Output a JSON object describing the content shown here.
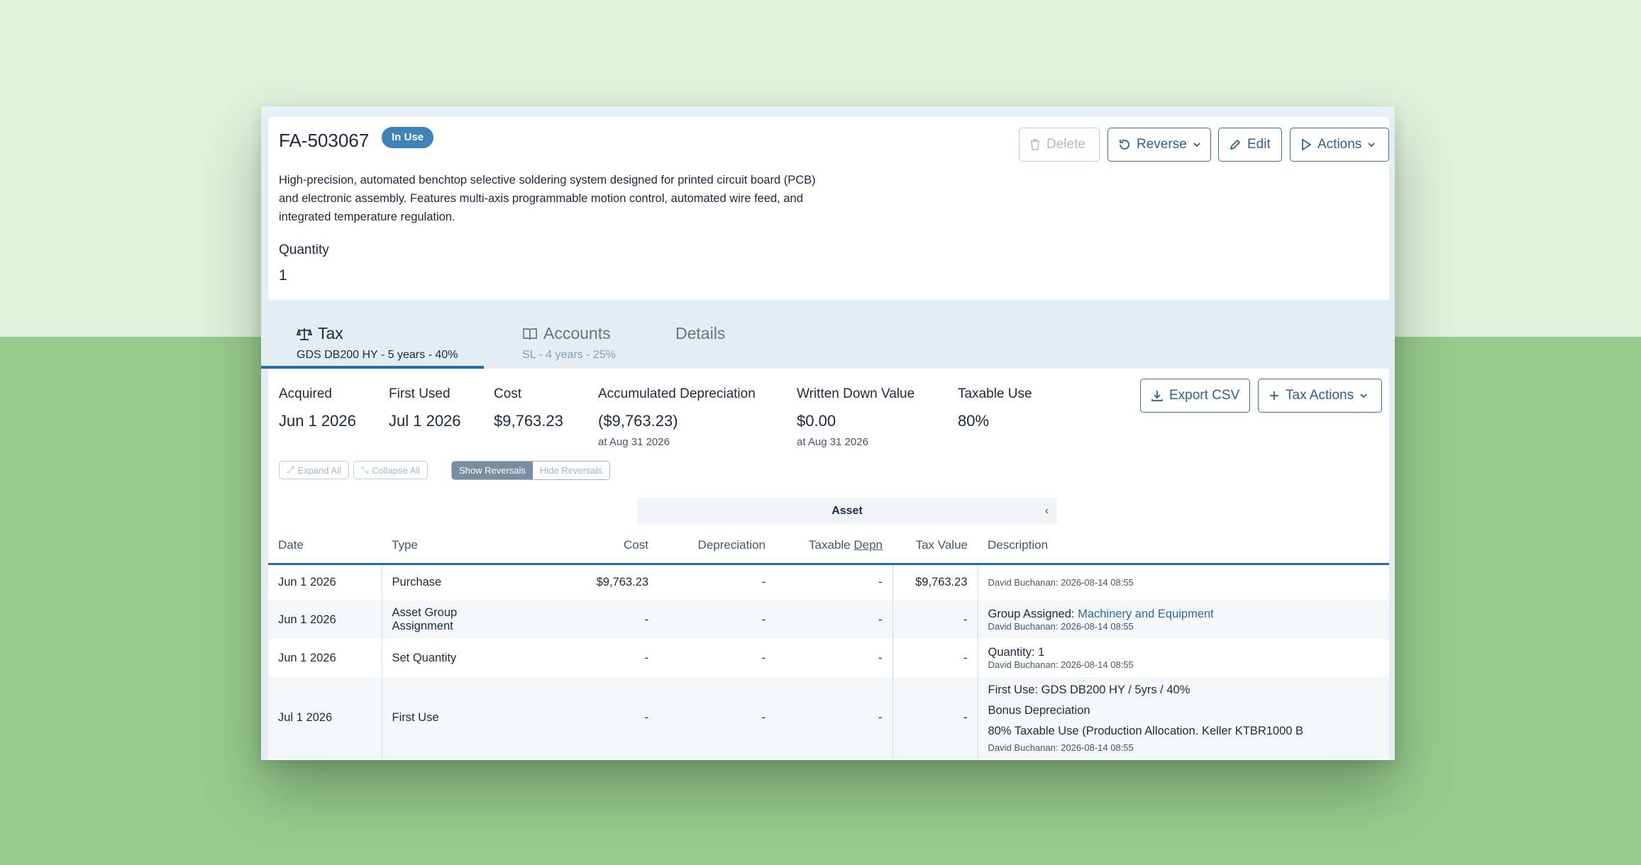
{
  "asset": {
    "id": "FA-503067",
    "status": "In Use",
    "description": "High-precision, automated benchtop selective soldering system designed for printed circuit board (PCB) and electronic assembly. Features multi-axis programmable motion control, automated wire feed, and integrated temperature regulation.",
    "quantity_label": "Quantity",
    "quantity_value": "1"
  },
  "toolbar": {
    "delete_label": "Delete",
    "reverse_label": "Reverse",
    "edit_label": "Edit",
    "actions_label": "Actions"
  },
  "tabs": [
    {
      "label": "Tax",
      "sub": "GDS DB200 HY - 5 years - 40%",
      "icon": "scale-icon",
      "active": true
    },
    {
      "label": "Accounts",
      "sub": "SL - 4 years - 25%",
      "icon": "book-icon",
      "active": false
    },
    {
      "label": "Details",
      "sub": "",
      "icon": "",
      "active": false
    }
  ],
  "summary": {
    "acquired": {
      "label": "Acquired",
      "value": "Jun 1 2026"
    },
    "first_used": {
      "label": "First Used",
      "value": "Jul 1 2026"
    },
    "cost": {
      "label": "Cost",
      "value": "$9,763.23"
    },
    "accum_depr": {
      "label": "Accumulated Depreciation",
      "value": "($9,763.23)",
      "note": "at Aug 31 2026"
    },
    "wdv": {
      "label": "Written Down Value",
      "value": "$0.00",
      "note": "at Aug 31 2026"
    },
    "taxable_use": {
      "label": "Taxable Use",
      "value": "80%"
    }
  },
  "actions": {
    "export_csv": "Export CSV",
    "tax_actions": "Tax Actions"
  },
  "controls": {
    "expand_all": "Expand All",
    "collapse_all": "Collapse All",
    "show_reversals": "Show Reversals",
    "hide_reversals": "Hide Reversals"
  },
  "table": {
    "group_header": "Asset",
    "columns": {
      "date": "Date",
      "type": "Type",
      "cost": "Cost",
      "depreciation": "Depreciation",
      "taxable_depn_a": "Taxable ",
      "taxable_depn_b": "Depn",
      "tax_value": "Tax Value",
      "description": "Description"
    },
    "rows": [
      {
        "date": "Jun 1 2026",
        "type": "Purchase",
        "cost": "$9,763.23",
        "depreciation": "-",
        "taxable_depn": "-",
        "tax_value": "$9,763.23",
        "audit": "David Buchanan: 2026-08-14 08:55"
      },
      {
        "date": "Jun 1 2026",
        "type": "Asset Group Assignment",
        "cost": "-",
        "depreciation": "-",
        "taxable_depn": "-",
        "tax_value": "-",
        "desc_label": "Group Assigned: ",
        "desc_link": "Machinery and Equipment",
        "audit": "David Buchanan: 2026-08-14 08:55"
      },
      {
        "date": "Jun 1 2026",
        "type": "Set Quantity",
        "cost": "-",
        "depreciation": "-",
        "taxable_depn": "-",
        "tax_value": "-",
        "desc": "Quantity: 1",
        "audit": "David Buchanan: 2026-08-14 08:55"
      },
      {
        "date": "Jul 1 2026",
        "type": "First Use",
        "cost": "-",
        "depreciation": "-",
        "taxable_depn": "-",
        "tax_value": "-",
        "desc_1": "First Use: GDS DB200 HY / 5yrs / 40%",
        "desc_2": "Bonus Depreciation",
        "desc_3": "80% Taxable Use (Production Allocation. Keller KTBR1000 B",
        "audit": "David Buchanan: 2026-08-14 08:55"
      }
    ]
  },
  "colors": {
    "accent": "#2d6a9f",
    "badge": "#3e82b8",
    "background_light": "#e0f2dc",
    "background_dark": "#97cb8d"
  }
}
